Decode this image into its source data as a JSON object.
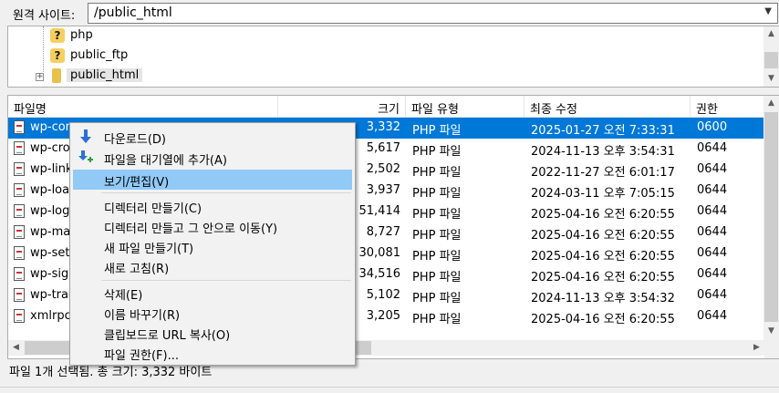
{
  "site_bar": {
    "label": "원격 사이트:",
    "path": "/public_html"
  },
  "tree": {
    "items": [
      {
        "name": "php",
        "icon": "question-folder-icon"
      },
      {
        "name": "public_ftp",
        "icon": "question-folder-icon"
      },
      {
        "name": "public_html",
        "icon": "folder-icon"
      }
    ]
  },
  "file_list": {
    "columns": [
      "파일명",
      "크기",
      "파일 유형",
      "최종 수정",
      "권한"
    ],
    "rows": [
      {
        "name": "wp-config.php",
        "name_visible": "wp-con",
        "size": "3,332",
        "type": "PHP 파일",
        "modified": "2025-01-27 오전 7:33:31",
        "perm": "0600",
        "selected": true
      },
      {
        "name_visible": "wp-cro",
        "size": "5,617",
        "type": "PHP 파일",
        "modified": "2024-11-13 오후 3:54:31",
        "perm": "0644"
      },
      {
        "name_visible": "wp-link",
        "size": "2,502",
        "type": "PHP 파일",
        "modified": "2022-11-27 오전 6:01:17",
        "perm": "0644"
      },
      {
        "name_visible": "wp-loa",
        "size": "3,937",
        "type": "PHP 파일",
        "modified": "2024-03-11 오후 7:05:15",
        "perm": "0644"
      },
      {
        "name_visible": "wp-log",
        "size": "51,414",
        "type": "PHP 파일",
        "modified": "2025-04-16 오전 6:20:55",
        "perm": "0644"
      },
      {
        "name_visible": "wp-ma",
        "size": "8,727",
        "type": "PHP 파일",
        "modified": "2025-04-16 오전 6:20:55",
        "perm": "0644"
      },
      {
        "name_visible": "wp-set",
        "size": "30,081",
        "type": "PHP 파일",
        "modified": "2025-04-16 오전 6:20:55",
        "perm": "0644"
      },
      {
        "name_visible": "wp-sign",
        "size": "34,516",
        "type": "PHP 파일",
        "modified": "2025-04-16 오전 6:20:55",
        "perm": "0644"
      },
      {
        "name_visible": "wp-trac",
        "size": "5,102",
        "type": "PHP 파일",
        "modified": "2024-11-13 오후 3:54:32",
        "perm": "0644"
      },
      {
        "name_visible": "xmlrpc",
        "size": "3,205",
        "type": "PHP 파일",
        "modified": "2025-04-16 오전 6:20:55",
        "perm": "0644"
      }
    ]
  },
  "status_text": "파일 1개 선택됨. 총 크기: 3,332 바이트",
  "context_menu": {
    "items": [
      {
        "label": "다운로드(D)",
        "icon": "download-icon"
      },
      {
        "label": "파일을 대기열에 추가(A)",
        "icon": "add-to-queue-icon"
      },
      {
        "label": "보기/편집(V)",
        "highlighted": true
      },
      {
        "separator": true
      },
      {
        "label": "디렉터리 만들기(C)"
      },
      {
        "label": "디렉터리 만들고 그 안으로 이동(Y)"
      },
      {
        "label": "새 파일 만들기(T)"
      },
      {
        "label": "새로 고침(R)"
      },
      {
        "separator": true
      },
      {
        "label": "삭제(E)"
      },
      {
        "label": "이름 바꾸기(R)"
      },
      {
        "label": "클립보드로 URL 복사(O)"
      },
      {
        "label": "파일 권한(F)..."
      }
    ]
  },
  "colors": {
    "selection": "#0078d7",
    "menu_highlight": "#91c9f7"
  }
}
